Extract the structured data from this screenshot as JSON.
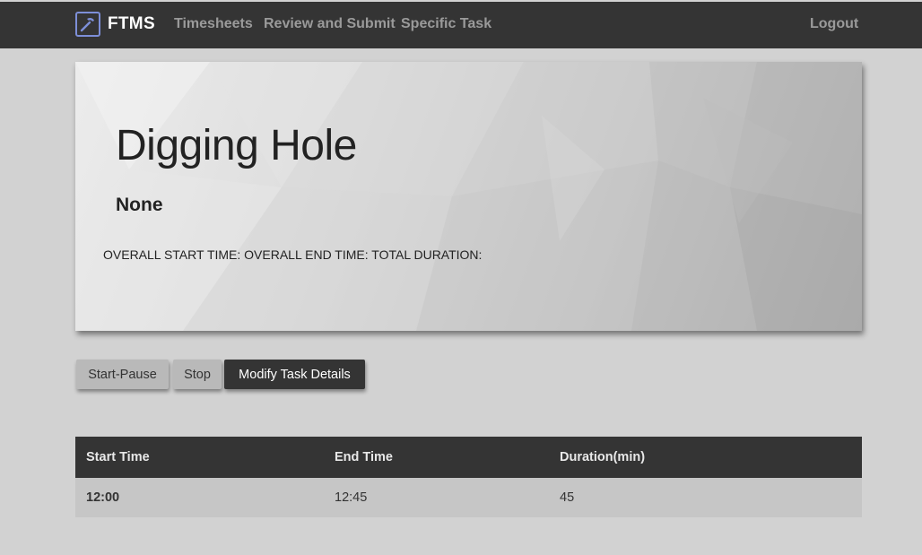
{
  "navbar": {
    "brand": "FTMS",
    "brand_icon": "hammer-icon",
    "links": [
      "Timesheets",
      "Review and Submit",
      "Specific Task"
    ],
    "logout": "Logout"
  },
  "task": {
    "title": "Digging Hole",
    "subtitle": "None",
    "times_line": "OVERALL START TIME: OVERALL END TIME: TOTAL DURATION:"
  },
  "buttons": {
    "start_pause": "Start-Pause",
    "stop": "Stop",
    "modify": "Modify Task Details"
  },
  "table": {
    "headers": [
      "Start Time",
      "End Time",
      "Duration(min)"
    ],
    "rows": [
      [
        "12:00",
        "12:45",
        "45"
      ]
    ]
  },
  "colors": {
    "navbar_bg": "#343434",
    "page_bg": "#d2d2d2",
    "brand_icon_accent": "#7d8fd8"
  }
}
